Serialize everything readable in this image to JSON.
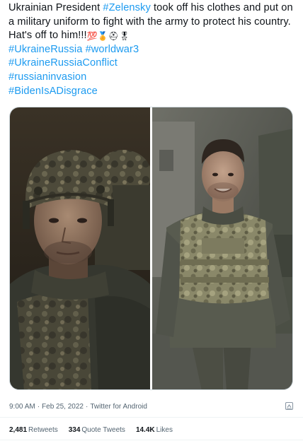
{
  "tweet": {
    "text_before": "Ukrainian President ",
    "mention": "#Zelensky",
    "text_after": " took off his clothes and put on a military uniform to fight with the army to protect his country. Hat's off to him!!!",
    "emojis": [
      "hundred-points",
      "medal",
      "military-helmet",
      "military-medal"
    ],
    "emoji_100": "💯",
    "emoji_medal": "🏅",
    "emoji_helmet": "⛑",
    "emoji_military_medal": "🎖",
    "hashtags_line1": [
      "#UkraineRussia",
      "#worldwar3"
    ],
    "hashtags": [
      "#UkraineRussiaConflict",
      "#russianinvasion",
      "#BidenIsADisgrace"
    ]
  },
  "media": {
    "photos": [
      "zelensky-in-helmet",
      "zelensky-in-body-armor"
    ]
  },
  "meta": {
    "time": "9:00 AM",
    "date": "Feb 25, 2022",
    "separator": "·",
    "source": "Twitter for Android",
    "icon": "report-icon"
  },
  "stats": [
    {
      "count": "2,481",
      "label": "Retweets"
    },
    {
      "count": "334",
      "label": "Quote Tweets"
    },
    {
      "count": "14.4K",
      "label": "Likes"
    }
  ],
  "colors": {
    "link": "#1d9bf0",
    "text": "#0f1419",
    "muted": "#536471",
    "border": "#cfd9de"
  }
}
